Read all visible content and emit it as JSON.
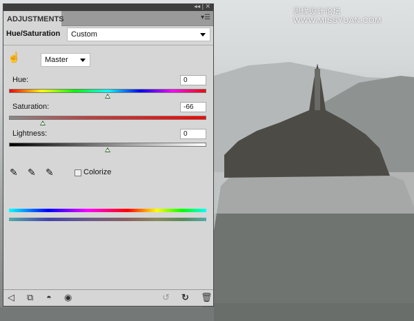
{
  "watermark": "思缘设计论坛 WWW.MISSYUAN.COM",
  "panel": {
    "titlebar_controls": "◂◂ | ✕",
    "tab": "ADJUSTMENTS",
    "menu_icon": "panel-menu-icon",
    "adjustment_name": "Hue/Saturation",
    "preset": "Custom",
    "channel": "Master",
    "hue": {
      "label": "Hue:",
      "value": "0",
      "position": 0.5
    },
    "saturation": {
      "label": "Saturation:",
      "value": "-66",
      "position": 0.17
    },
    "lightness": {
      "label": "Lightness:",
      "value": "0",
      "position": 0.5
    },
    "colorize_label": "Colorize",
    "colorize_checked": false
  },
  "toolbar": {
    "icons": [
      "back-icon",
      "clip-to-layer-icon",
      "previous-state-icon",
      "visibility-eye-icon",
      "view-previous-icon",
      "reset-icon",
      "delete-icon"
    ]
  }
}
